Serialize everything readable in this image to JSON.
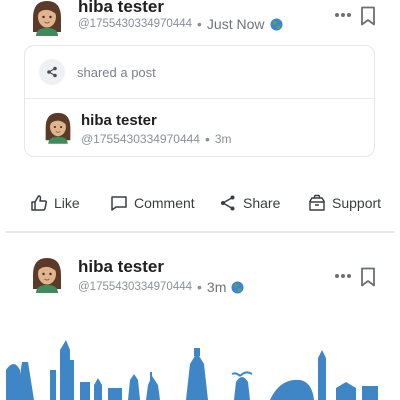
{
  "post1": {
    "author": "hiba tester",
    "handle": "@1755430334970444",
    "separator": "•",
    "time": "Just Now"
  },
  "shared": {
    "label": "shared a post",
    "author": "hiba tester",
    "handle": "@1755430334970444",
    "separator": "•",
    "time": "3m"
  },
  "actions": {
    "like": "Like",
    "comment": "Comment",
    "share": "Share",
    "support": "Support"
  },
  "post2": {
    "author": "hiba tester",
    "handle": "@1755430334970444",
    "separator": "•",
    "time": "3m"
  },
  "colors": {
    "skyline": "#3f86c6",
    "text": "#1f1f1f",
    "muted": "#8a8f98"
  },
  "icons": [
    "avatar",
    "globe-icon",
    "more-icon",
    "bookmark-icon",
    "share-icon",
    "like-icon",
    "comment-icon",
    "support-icon"
  ]
}
